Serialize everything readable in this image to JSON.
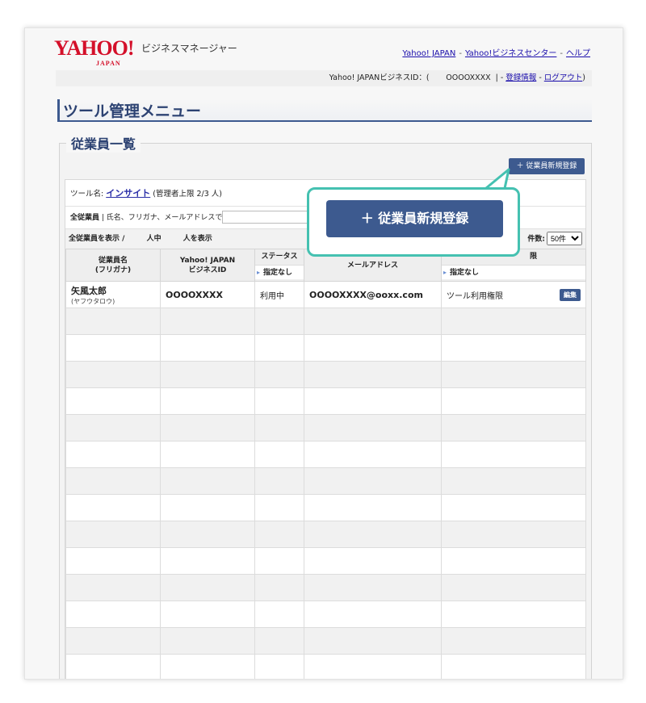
{
  "logo": {
    "word": "YAHOO!",
    "sub": "JAPAN"
  },
  "brand": "ビジネスマネージャー",
  "toplinks": [
    {
      "label": "Yahoo! JAPAN"
    },
    {
      "label": "Yahoo!ビジネスセンター"
    },
    {
      "label": "ヘルプ"
    }
  ],
  "idbar": {
    "prefix": "Yahoo! JAPANビジネスID：(",
    "value": "OOOOXXXX",
    "register": "登録情報",
    "logout": "ログアウト",
    "close": ")"
  },
  "page_title": "ツール管理メニュー",
  "section_title": "従業員一覧",
  "add_button": "＋ 従業員新規登録",
  "add_button_big": "＋ 従業員新規登録",
  "tool": {
    "prefix": "ツール名:",
    "name": "インサイト",
    "suffix": "(管理者上限 2/3 人)"
  },
  "search": {
    "label": "全従業員",
    "hint": "氏名、フリガナ、メールアドレスで検索"
  },
  "filterrow": {
    "label": "全従業員を表示 /",
    "mid": "人中",
    "end": "人を表示",
    "pagesize_label": "件数:",
    "pagesize_value": "50件"
  },
  "table": {
    "headers": {
      "name": "従業員名",
      "name_sub": "(フリガナ)",
      "id": "Yahoo! JAPAN",
      "id_sub": "ビジネスID",
      "status": "ステータス",
      "status_filter": "指定なし",
      "email": "メールアドレス",
      "perm": "限",
      "perm_filter": "指定なし"
    },
    "row": {
      "name": "矢風太郎",
      "kana": "(ヤフウタロウ)",
      "id": "OOOOXXXX",
      "status": "利用中",
      "email": "OOOOXXXX@ooxx.com",
      "perm": "ツール利用権限",
      "edit": "編集"
    }
  },
  "colors": {
    "accent": "#3d5a8f",
    "callout": "#45c1b1",
    "logo": "#d4102a"
  }
}
